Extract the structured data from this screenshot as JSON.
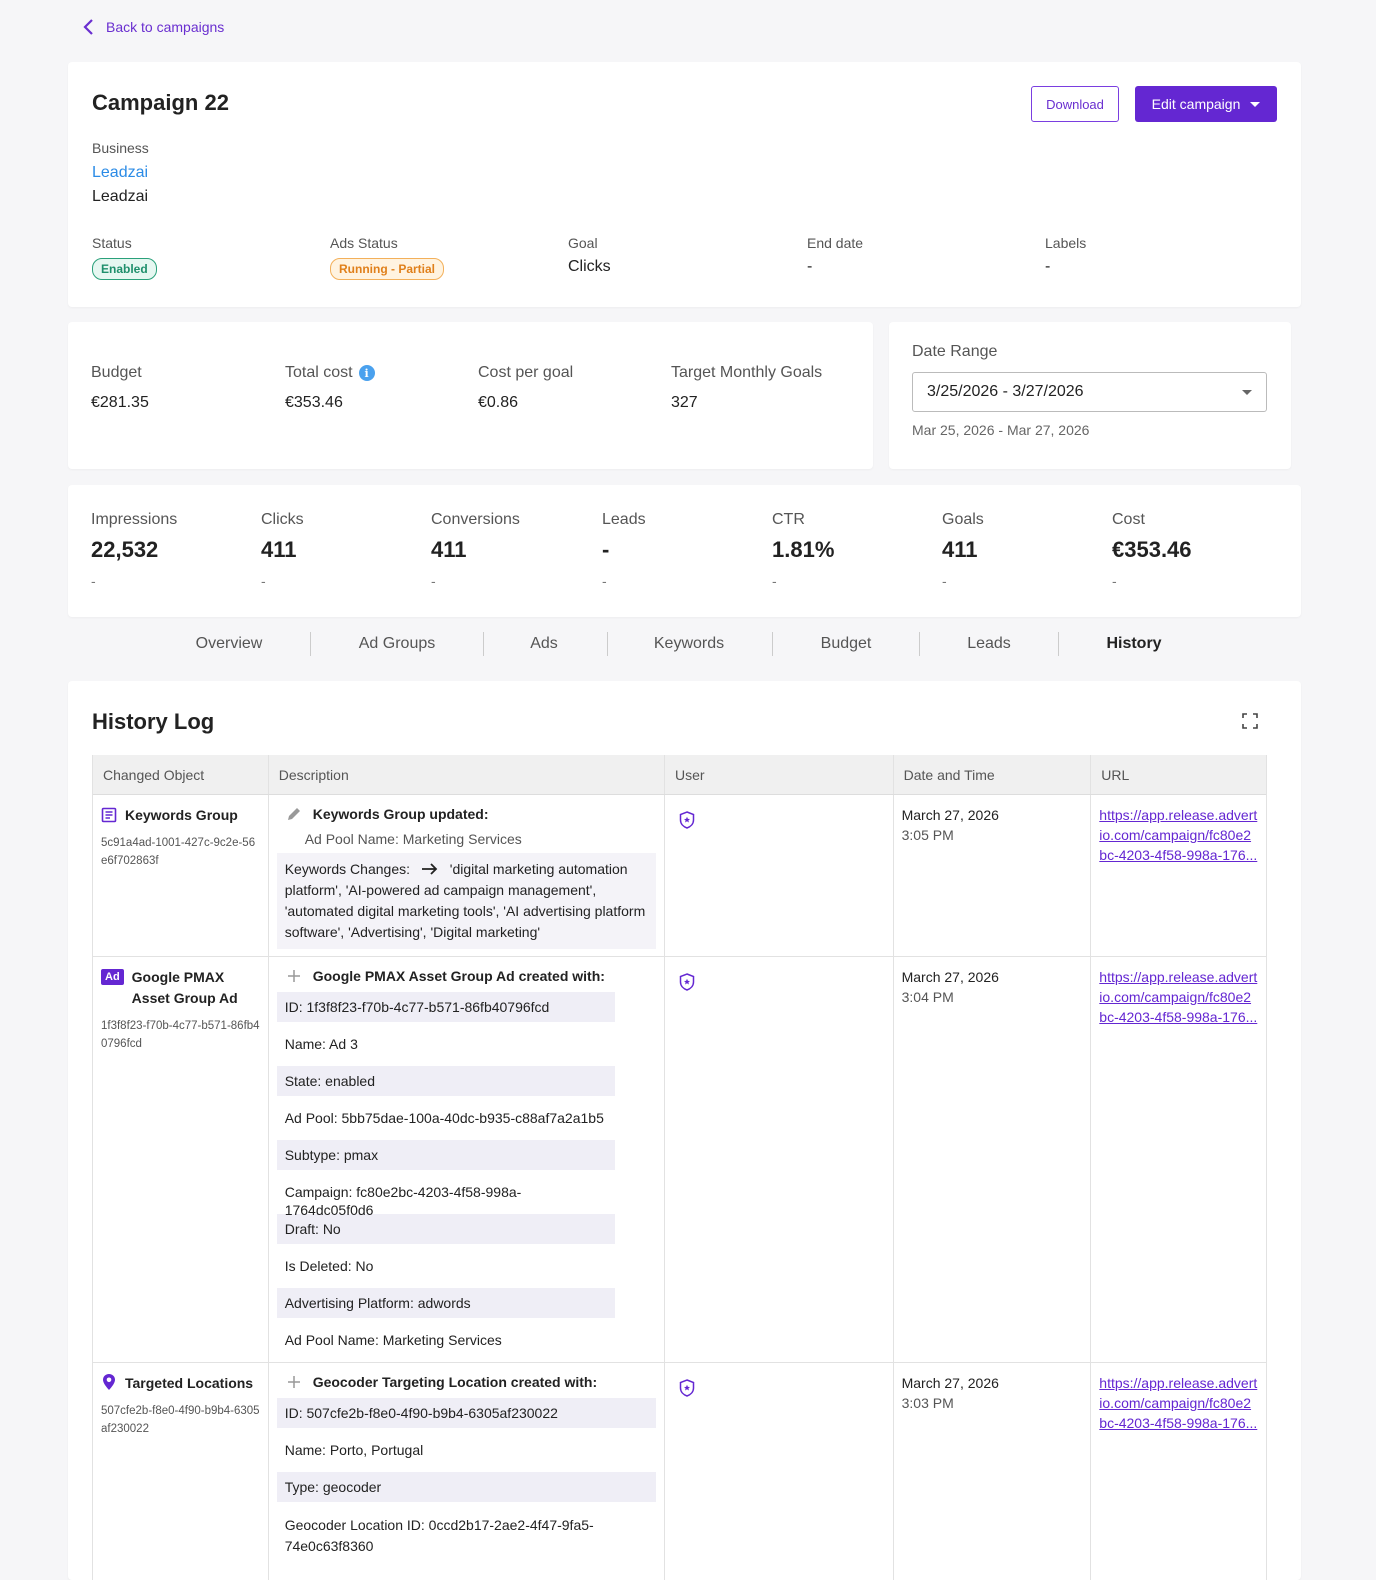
{
  "nav": {
    "back_label": "Back to campaigns"
  },
  "campaign": {
    "title": "Campaign 22",
    "download_label": "Download",
    "edit_label": "Edit campaign",
    "business_label": "Business",
    "business_link": "Leadzai",
    "business_name": "Leadzai",
    "status_label": "Status",
    "status_value": "Enabled",
    "ads_status_label": "Ads Status",
    "ads_status_value": "Running - Partial",
    "goal_label": "Goal",
    "goal_value": "Clicks",
    "end_date_label": "End date",
    "end_date_value": "-",
    "labels_label": "Labels",
    "labels_value": "-"
  },
  "budget": {
    "budget_label": "Budget",
    "budget_value": "€281.35",
    "total_cost_label": "Total cost",
    "total_cost_value": "€353.46",
    "cost_per_goal_label": "Cost per goal",
    "cost_per_goal_value": "€0.86",
    "target_label": "Target Monthly Goals",
    "target_value": "327"
  },
  "date_range": {
    "label": "Date Range",
    "value": "3/25/2026 - 3/27/2026",
    "sub": "Mar 25, 2026 - Mar 27, 2026"
  },
  "metrics": [
    {
      "label": "Impressions",
      "value": "22,532",
      "delta": "-"
    },
    {
      "label": "Clicks",
      "value": "411",
      "delta": "-"
    },
    {
      "label": "Conversions",
      "value": "411",
      "delta": "-"
    },
    {
      "label": "Leads",
      "value": "-",
      "delta": "-"
    },
    {
      "label": "CTR",
      "value": "1.81%",
      "delta": "-"
    },
    {
      "label": "Goals",
      "value": "411",
      "delta": "-"
    },
    {
      "label": "Cost",
      "value": "€353.46",
      "delta": "-"
    }
  ],
  "tabs": [
    "Overview",
    "Ad Groups",
    "Ads",
    "Keywords",
    "Budget",
    "Leads",
    "History"
  ],
  "active_tab": "History",
  "history": {
    "title": "History Log",
    "columns": [
      "Changed Object",
      "Description",
      "User",
      "Date and Time",
      "URL"
    ],
    "rows": [
      {
        "object_name": "Keywords Group",
        "object_id": "5c91a4ad-1001-427c-9c2e-56e6f702863f",
        "desc_title": "Keywords Group updated:",
        "pool": "Ad Pool Name: Marketing Services",
        "kw_prefix": "Keywords Changes:",
        "kw_text": "'digital marketing automation platform', 'AI-powered ad campaign management', 'automated digital marketing tools', 'AI advertising platform software', 'Advertising', 'Digital marketing'",
        "date": "March 27, 2026",
        "time": "3:05 PM",
        "url": "https://app.release.advertio.com/campaign/fc80e2bc-4203-4f58-998a-176..."
      },
      {
        "object_badge": "Ad",
        "object_name": "Google PMAX Asset Group Ad",
        "object_id": "1f3f8f23-f70b-4c77-b571-86fb40796fcd",
        "desc_title": "Google PMAX Asset Group Ad created with:",
        "fields": [
          "ID: 1f3f8f23-f70b-4c77-b571-86fb40796fcd",
          "Name: Ad 3",
          "State: enabled",
          "Ad Pool: 5bb75dae-100a-40dc-b935-c88af7a2a1b5",
          "Subtype: pmax",
          "Campaign: fc80e2bc-4203-4f58-998a-1764dc05f0d6",
          "Draft: No",
          "Is Deleted: No",
          "Advertising Platform: adwords",
          "Ad Pool Name: Marketing Services"
        ],
        "date": "March 27, 2026",
        "time": "3:04 PM",
        "url": "https://app.release.advertio.com/campaign/fc80e2bc-4203-4f58-998a-176..."
      },
      {
        "object_name": "Targeted Locations",
        "object_id": "507cfe2b-f8e0-4f90-b9b4-6305af230022",
        "desc_title": "Geocoder Targeting Location created with:",
        "fields": [
          "ID: 507cfe2b-f8e0-4f90-b9b4-6305af230022",
          "Name: Porto, Portugal",
          "Type: geocoder",
          "Geocoder Location ID: 0ccd2b17-2ae2-4f47-9fa5-74e0c63f8360"
        ],
        "date": "March 27, 2026",
        "time": "3:03 PM",
        "url": "https://app.release.advertio.com/campaign/fc80e2bc-4203-4f58-998a-176..."
      }
    ]
  },
  "colors": {
    "accent": "#6427d2",
    "link": "#2b8be6"
  }
}
